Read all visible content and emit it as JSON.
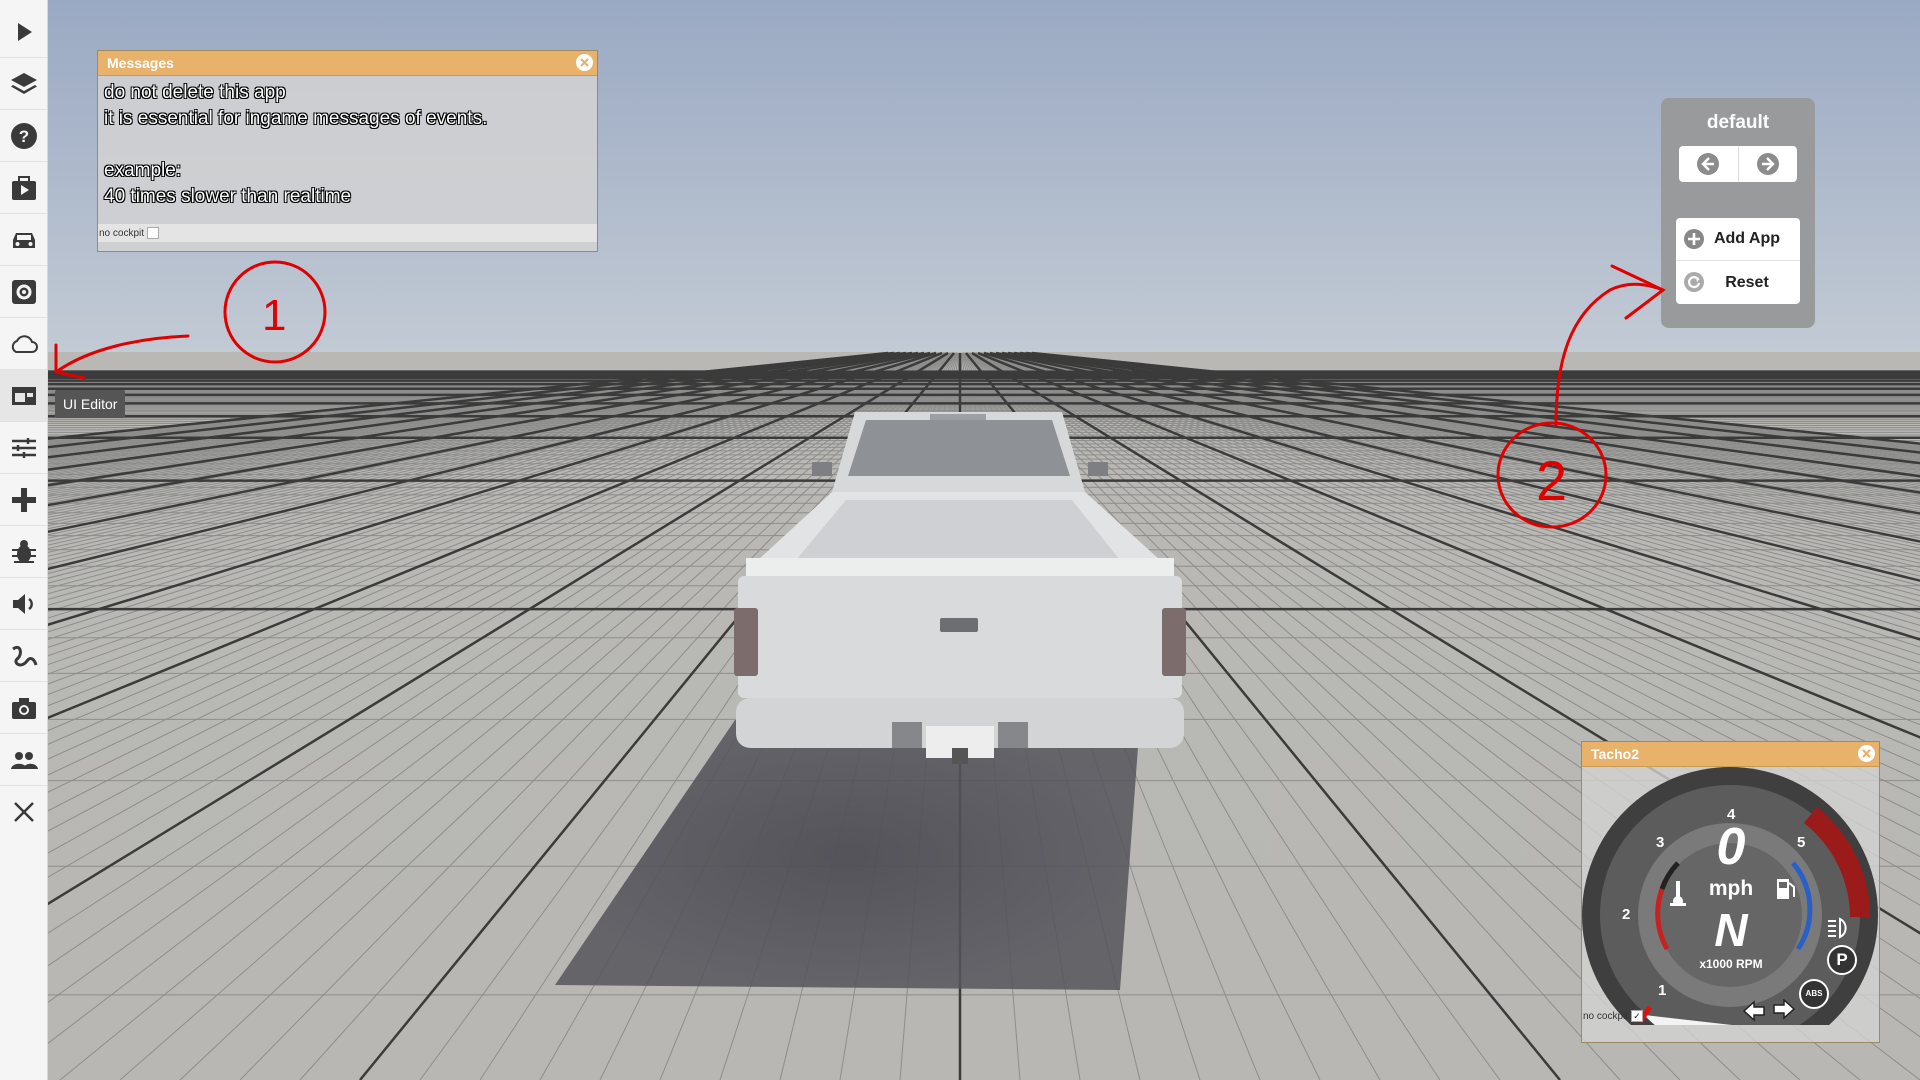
{
  "sidebar": {
    "items": [
      {
        "icon": "play-icon"
      },
      {
        "icon": "layers-icon"
      },
      {
        "icon": "help-icon"
      },
      {
        "icon": "scenario-icon"
      },
      {
        "icon": "car-icon"
      },
      {
        "icon": "settings-gear-icon"
      },
      {
        "icon": "cloud-icon"
      },
      {
        "icon": "ui-editor-icon"
      },
      {
        "icon": "sliders-icon"
      },
      {
        "icon": "gamepad-icon"
      },
      {
        "icon": "bug-icon"
      },
      {
        "icon": "audio-icon"
      },
      {
        "icon": "road-icon"
      },
      {
        "icon": "camera-icon"
      },
      {
        "icon": "users-icon"
      },
      {
        "icon": "close-icon"
      }
    ],
    "tooltip": "UI Editor"
  },
  "messages_app": {
    "title": "Messages",
    "lines": "do not delete this app\nit is essential for ingame messages of events.\n\nexample:\n40 times slower than realtime",
    "cockpit_label": "no cockpit"
  },
  "layout_panel": {
    "title": "default",
    "add_app_label": "Add App",
    "reset_label": "Reset"
  },
  "tacho": {
    "title": "Tacho2",
    "speed": "0",
    "speed_unit": "mph",
    "gear": "N",
    "rpm_unit": "x1000 RPM",
    "rpm_ticks": [
      "1",
      "2",
      "3",
      "4",
      "5"
    ],
    "parking_label": "P",
    "abs_label": "ABS",
    "cockpit_label": "no cockpit",
    "cockpit_checked": "✓"
  },
  "annotations": [
    "1",
    "2"
  ],
  "colors": {
    "app_title": "#e8b26a",
    "redline": "#9b1b1b",
    "annotation": "#e00000"
  }
}
